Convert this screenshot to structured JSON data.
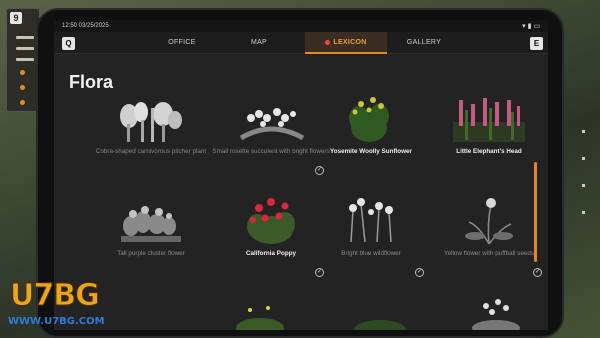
{
  "background": {
    "badge": "9",
    "watermark_text": "U7BG",
    "watermark_url": "WWW.U7BG.COM"
  },
  "status": {
    "time": "12:50  03/25/2025",
    "icons": "▾ ▮ ▭"
  },
  "nav": {
    "left_key": "Q",
    "right_key": "E",
    "tabs": [
      "OFFICE",
      "MAP",
      "LEXICON",
      "GALLERY"
    ],
    "active_tab": "LEXICON"
  },
  "page": {
    "title": "Flora"
  },
  "plants": [
    {
      "label": "Cobra-shaped carnivorous pitcher plant",
      "discovered": false,
      "checked": false
    },
    {
      "label": "Small rosette succulent with bright flowers",
      "discovered": false,
      "checked": true
    },
    {
      "label": "Yosemite Woolly Sunflower",
      "discovered": true,
      "checked": false
    },
    {
      "label": "Little Elephant's Head",
      "discovered": true,
      "checked": false
    },
    {
      "label": "Tall purple cluster flower",
      "discovered": false,
      "checked": false
    },
    {
      "label": "California Poppy",
      "discovered": true,
      "checked": true
    },
    {
      "label": "Bright blue wildflower",
      "discovered": false,
      "checked": true
    },
    {
      "label": "Yellow flower with puffball seeds",
      "discovered": false,
      "checked": true
    }
  ]
}
